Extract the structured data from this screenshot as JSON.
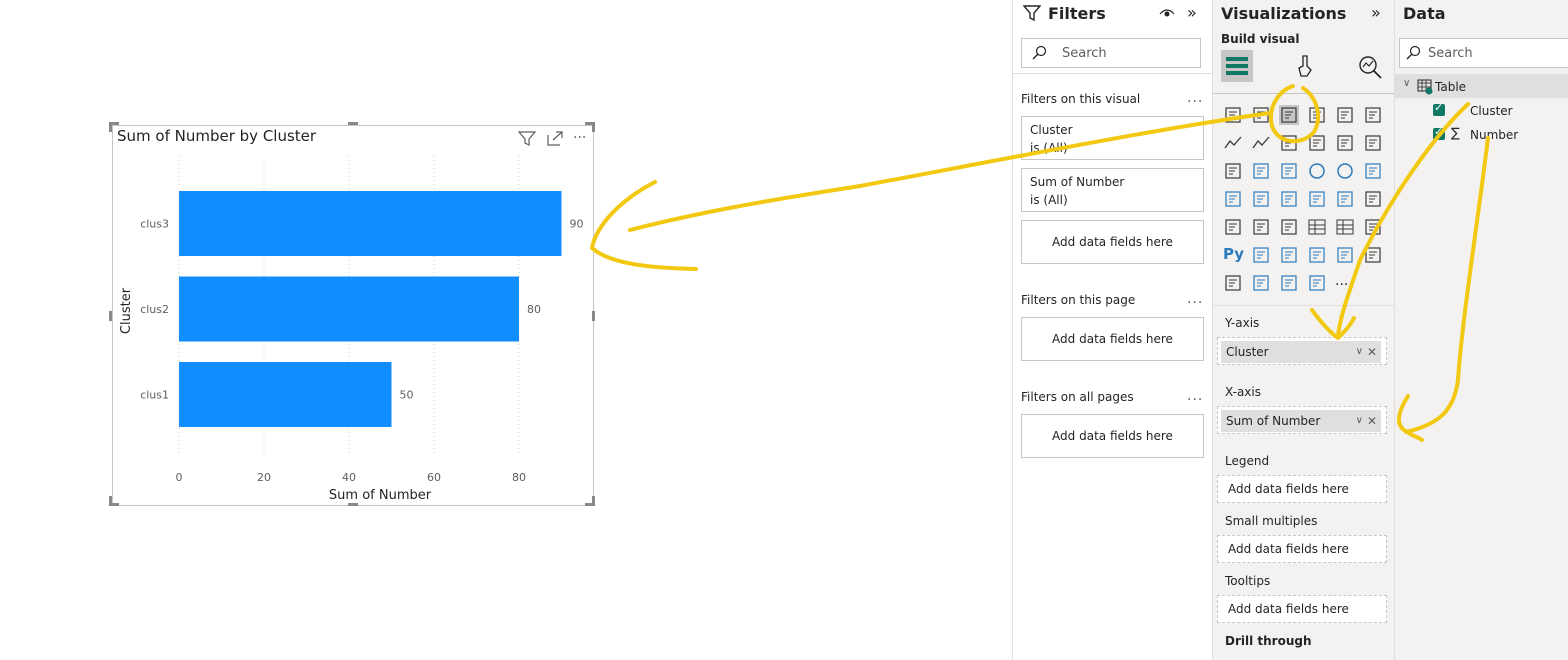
{
  "visual": {
    "title": "Sum of Number by Cluster",
    "icons": [
      "filter-icon",
      "focus-mode-icon",
      "more-options-icon"
    ]
  },
  "chart_data": {
    "type": "bar",
    "orientation": "horizontal",
    "title": "Sum of Number by Cluster",
    "categories": [
      "clus3",
      "clus2",
      "clus1"
    ],
    "values": [
      90,
      80,
      50
    ],
    "xlabel": "Sum of Number",
    "ylabel": "Cluster",
    "xlim": [
      0,
      90
    ],
    "xticks": [
      "0",
      "20",
      "40",
      "60",
      "80"
    ],
    "grid": true,
    "color": "#118DFF"
  },
  "filters": {
    "title": "Filters",
    "search_placeholder": "Search",
    "on_visual_label": "Filters on this visual",
    "on_visual_cards": [
      {
        "name": "Cluster",
        "state": "is (All)"
      },
      {
        "name": "Sum of Number",
        "state": "is (All)"
      }
    ],
    "add_fields": "Add data fields here",
    "on_page_label": "Filters on this page",
    "on_all_label": "Filters on all pages",
    "more": "..."
  },
  "visualizations": {
    "title": "Visualizations",
    "build_label": "Build visual",
    "wells": {
      "y_axis": {
        "label": "Y-axis",
        "field": "Cluster"
      },
      "x_axis": {
        "label": "X-axis",
        "field": "Sum of Number"
      },
      "legend": {
        "label": "Legend",
        "placeholder": "Add data fields here"
      },
      "small_multiples": {
        "label": "Small multiples",
        "placeholder": "Add data fields here"
      },
      "tooltips": {
        "label": "Tooltips",
        "placeholder": "Add data fields here"
      },
      "drill_through": {
        "label": "Drill through"
      }
    },
    "python_label": "Py",
    "more": "..."
  },
  "data_pane": {
    "title": "Data",
    "search_placeholder": "Search",
    "table": {
      "name": "Table",
      "fields": [
        "Cluster",
        "Number"
      ]
    }
  },
  "colors": {
    "bar": "#118DFF",
    "annotation": "#F2C811",
    "checkbox": "#117865"
  }
}
